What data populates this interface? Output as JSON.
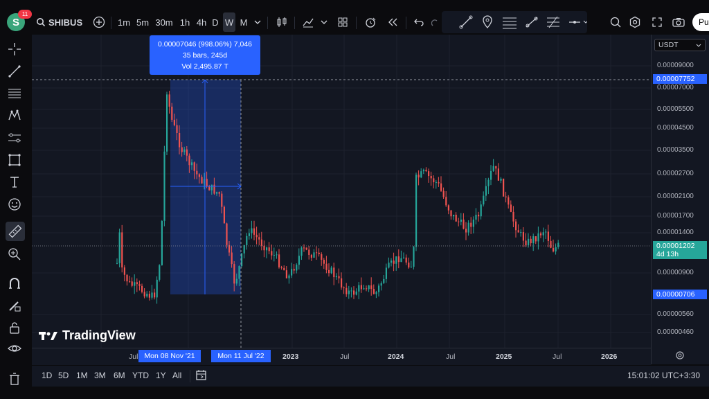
{
  "header": {
    "avatar_letter": "S",
    "notifications": "11",
    "symbol": "SHIBUSD",
    "timeframes": [
      "1m",
      "5m",
      "30m",
      "1h",
      "4h",
      "D",
      "W",
      "M"
    ],
    "active_timeframe": "W",
    "publish_label": "Pu"
  },
  "price_scale": {
    "currency": "USDT",
    "labels": [
      "0.00009000",
      "0.00007000",
      "0.00005500",
      "0.00004500",
      "0.00003500",
      "0.00002700",
      "0.00002100",
      "0.00001700",
      "0.00001400",
      "0.00000900",
      "0.00000560",
      "0.00000460"
    ],
    "high_tag": "0.00007752",
    "current_price": "0.00001202",
    "countdown": "4d 13h",
    "low_tag": "0.00000706"
  },
  "time_scale": {
    "labels": [
      "Jul",
      "2023",
      "Jul",
      "2024",
      "Jul",
      "2025",
      "Jul",
      "2026"
    ],
    "badge_start": "Mon 08 Nov '21",
    "badge_end": "Mon 11 Jul '22"
  },
  "measure": {
    "line1": "0.00007046 (998.06%) 7,046",
    "line2": "35 bars, 245d",
    "line3": "Vol 2,495.87 T"
  },
  "watermark": "TradingView",
  "bottom": {
    "ranges": [
      "1D",
      "5D",
      "1M",
      "3M",
      "6M",
      "YTD",
      "1Y",
      "All"
    ],
    "clock": "15:01:02 UTC+3:30"
  },
  "colors": {
    "up": "#26a69a",
    "down": "#ef5350",
    "accent": "#2962ff",
    "bg": "#131722"
  }
}
